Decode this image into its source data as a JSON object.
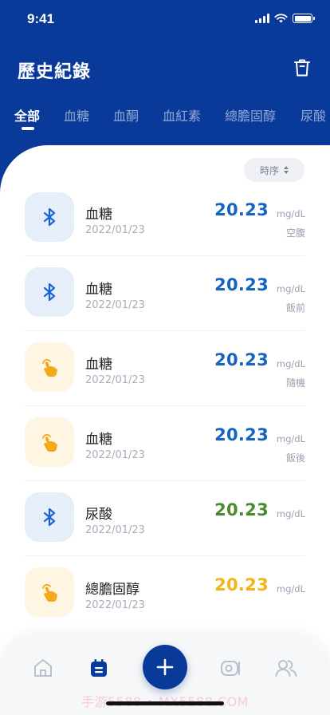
{
  "status_bar": {
    "time": "9:41"
  },
  "header": {
    "title": "歷史紀錄"
  },
  "tabs": [
    {
      "label": "全部",
      "active": true
    },
    {
      "label": "血糖",
      "active": false
    },
    {
      "label": "血酮",
      "active": false
    },
    {
      "label": "血紅素",
      "active": false
    },
    {
      "label": "總膽固醇",
      "active": false
    },
    {
      "label": "尿酸",
      "active": false
    }
  ],
  "sort": {
    "label": "時序"
  },
  "records": [
    {
      "icon": "bluetooth-icon",
      "name": "血糖",
      "date": "2022/01/23",
      "value": "20.23",
      "unit": "mg/dL",
      "tag": "空腹",
      "color": "#1565C0"
    },
    {
      "icon": "bluetooth-icon",
      "name": "血糖",
      "date": "2022/01/23",
      "value": "20.23",
      "unit": "mg/dL",
      "tag": "飯前",
      "color": "#1565C0"
    },
    {
      "icon": "hand-tap-icon",
      "name": "血糖",
      "date": "2022/01/23",
      "value": "20.23",
      "unit": "mg/dL",
      "tag": "隨機",
      "color": "#1565C0"
    },
    {
      "icon": "hand-tap-icon",
      "name": "血糖",
      "date": "2022/01/23",
      "value": "20.23",
      "unit": "mg/dL",
      "tag": "飯後",
      "color": "#1565C0"
    },
    {
      "icon": "bluetooth-icon",
      "name": "尿酸",
      "date": "2022/01/23",
      "value": "20.23",
      "unit": "mg/dL",
      "tag": "",
      "color": "#4C8A2E"
    },
    {
      "icon": "hand-tap-icon",
      "name": "總膽固醇",
      "date": "2022/01/23",
      "value": "20.23",
      "unit": "mg/dL",
      "tag": "",
      "color": "#F2B418"
    }
  ],
  "bottom_nav": [
    "home-icon",
    "calendar-icon",
    "add-icon",
    "camera-icon",
    "users-icon"
  ],
  "watermark": "手游5588 • MX5588.COM",
  "colors": {
    "primary": "#0A3A99",
    "bluetooth": "#1E63D6",
    "hand": "#F2A91A"
  }
}
